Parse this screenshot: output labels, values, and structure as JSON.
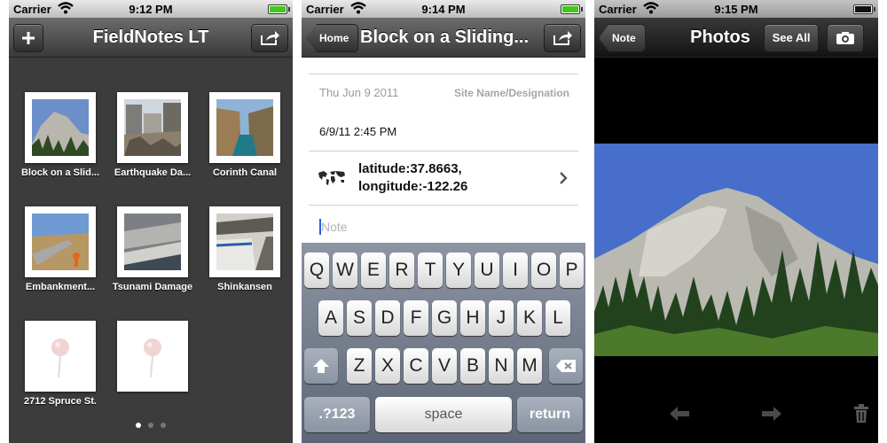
{
  "status": [
    {
      "carrier": "Carrier",
      "time": "9:12 PM",
      "battery": 1.0
    },
    {
      "carrier": "Carrier",
      "time": "9:14 PM",
      "battery": 1.0
    },
    {
      "carrier": "Carrier",
      "time": "9:15 PM",
      "battery": 1.0
    }
  ],
  "panel1": {
    "title": "FieldNotes LT",
    "add_icon": "plus-icon",
    "share_icon": "share-icon",
    "notes": [
      {
        "label": "Block on a Slid..."
      },
      {
        "label": "Earthquake Da..."
      },
      {
        "label": "Corinth Canal"
      },
      {
        "label": "Embankment..."
      },
      {
        "label": "Tsunami Damage"
      },
      {
        "label": "Shinkansen"
      },
      {
        "label": "2712 Spruce St."
      },
      {
        "label": ""
      }
    ],
    "page_count": 3,
    "current_page": 1
  },
  "panel2": {
    "back_label": "Home",
    "title": "Block on a Sliding...",
    "date": "Thu Jun 9 2011",
    "site_placeholder": "Site Name/Designation",
    "timestamp": "6/9/11 2:45 PM",
    "latitude": "latitude:37.8663,",
    "longitude": "longitude:-122.26",
    "note_placeholder": "Note",
    "keys_row1": [
      "Q",
      "W",
      "E",
      "R",
      "T",
      "Y",
      "U",
      "I",
      "O",
      "P"
    ],
    "keys_row2": [
      "A",
      "S",
      "D",
      "F",
      "G",
      "H",
      "J",
      "K",
      "L"
    ],
    "keys_row3": [
      "Z",
      "X",
      "C",
      "V",
      "B",
      "N",
      "M"
    ],
    "numbers_key": ".?123",
    "space_key": "space",
    "return_key": "return"
  },
  "panel3": {
    "back_label": "Note",
    "title": "Photos",
    "see_all_label": "See All",
    "camera_icon": "camera-icon",
    "prev_icon": "arrow-left-icon",
    "next_icon": "arrow-right-icon",
    "trash_icon": "trash-icon"
  }
}
